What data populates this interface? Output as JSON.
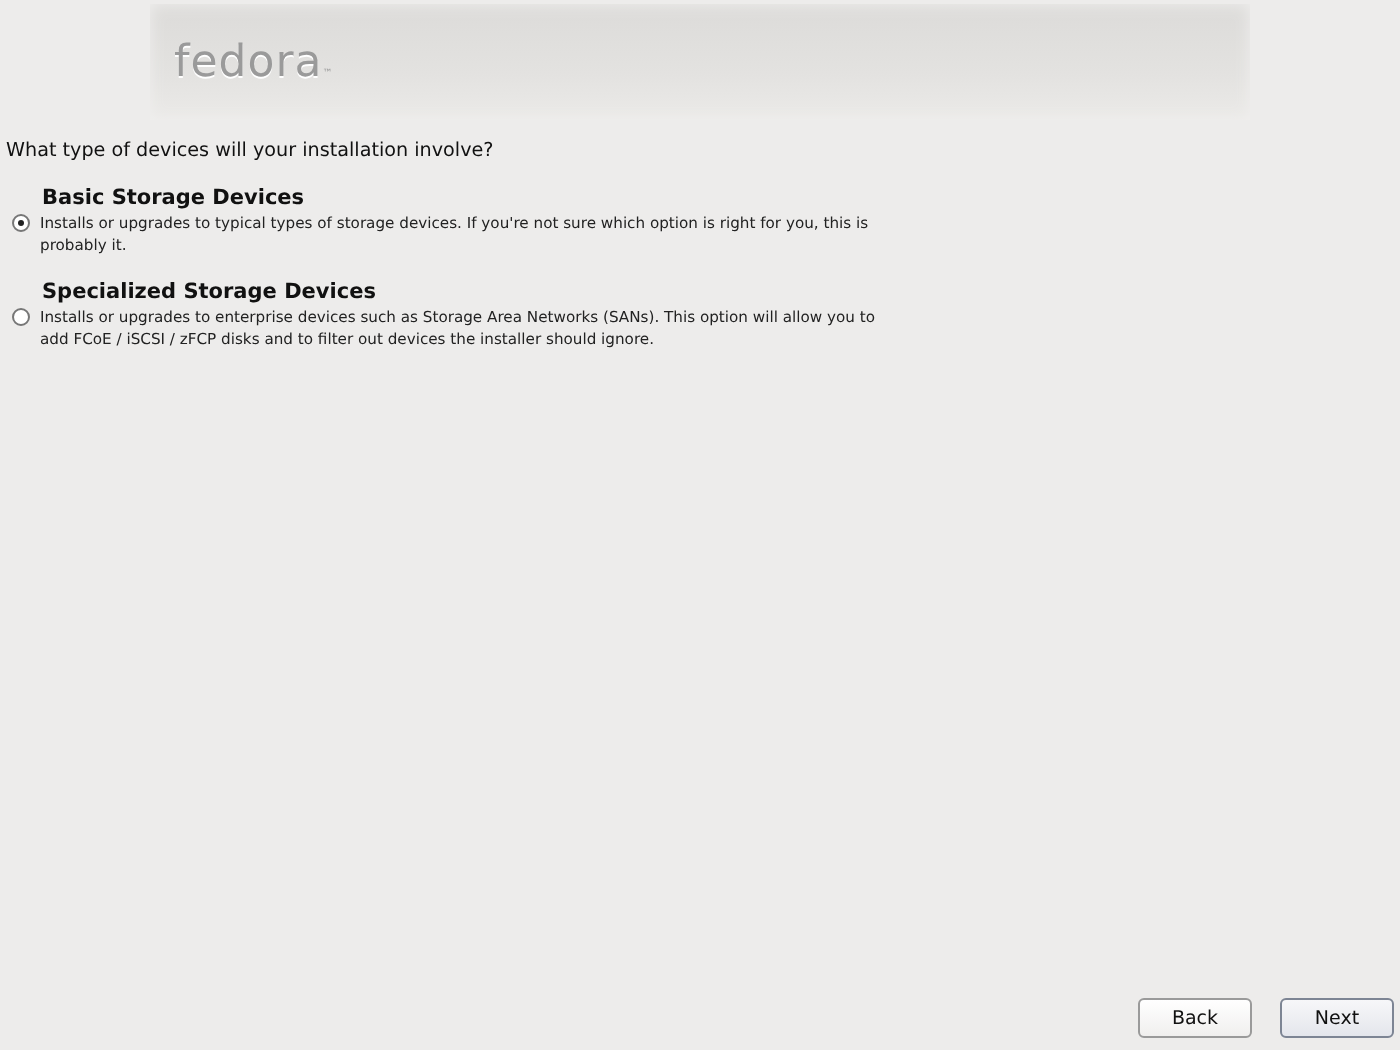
{
  "header": {
    "logo": "fedora",
    "logo_mark": "™"
  },
  "question": "What type of devices will your installation involve?",
  "options": [
    {
      "title": "Basic Storage Devices",
      "description": "Installs or upgrades to typical types of storage devices.  If you're not sure which option is right for you, this is probably it.",
      "selected": true
    },
    {
      "title": "Specialized Storage Devices",
      "description": "Installs or upgrades to enterprise devices such as Storage Area Networks (SANs). This option will allow you to add FCoE / iSCSI / zFCP disks and to filter out devices the installer should ignore.",
      "selected": false
    }
  ],
  "buttons": [
    {
      "label": "Back",
      "kind": "back"
    },
    {
      "label": "Next",
      "kind": "next"
    }
  ]
}
